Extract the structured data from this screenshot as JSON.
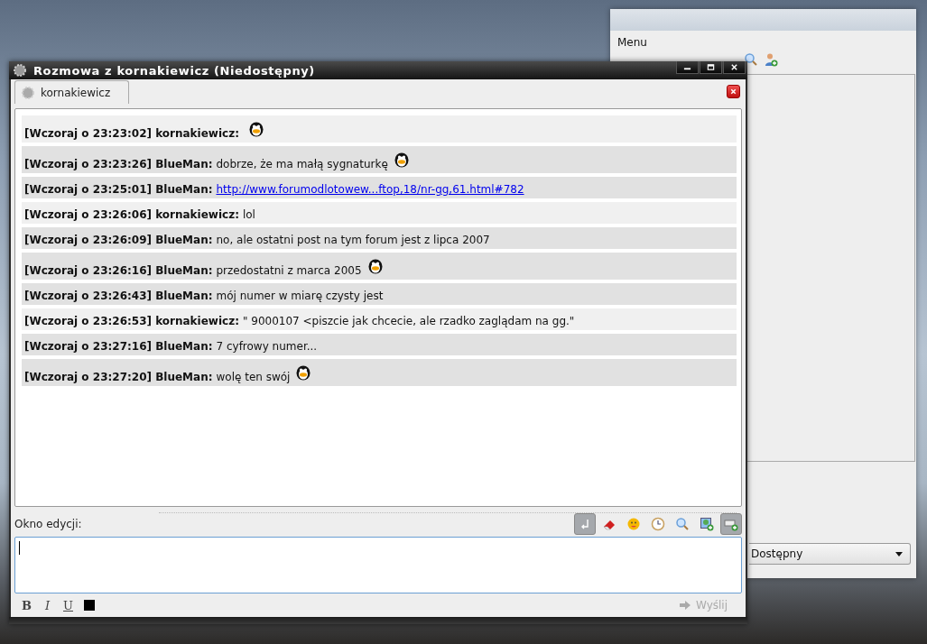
{
  "back_window": {
    "menu": "Menu",
    "status": "Dostępny"
  },
  "window": {
    "title": "Rozmowa z kornakiewicz (Niedostępny)"
  },
  "tabs": [
    {
      "label": "kornakiewicz",
      "selected": true
    }
  ],
  "messages": [
    {
      "kind": "incoming",
      "header": "[Wczoraj o 23:23:02] kornakiewicz:",
      "emoticon": true
    },
    {
      "kind": "outgoing",
      "header": "[Wczoraj o 23:23:26] BlueMan:",
      "text": "dobrze, że ma małą sygnaturkę",
      "emoticon": true
    },
    {
      "kind": "outgoing",
      "header": "[Wczoraj o 23:25:01] BlueMan:",
      "link": "http://www.forumodlotowew...ftop,18/nr-gg,61.html#782",
      "emoticon": false
    },
    {
      "kind": "incoming",
      "header": "[Wczoraj o 23:26:06] kornakiewicz:",
      "text": "lol",
      "emoticon": false
    },
    {
      "kind": "outgoing",
      "header": "[Wczoraj o 23:26:09] BlueMan:",
      "text": "no, ale ostatni post na tym forum jest z lipca 2007",
      "emoticon": false
    },
    {
      "kind": "outgoing",
      "header": "[Wczoraj o 23:26:16] BlueMan:",
      "text": "przedostatni z marca 2005",
      "emoticon": true
    },
    {
      "kind": "outgoing",
      "header": "[Wczoraj o 23:26:43] BlueMan:",
      "text": "mój numer w miarę czysty jest",
      "emoticon": false
    },
    {
      "kind": "incoming",
      "header": "[Wczoraj o 23:26:53] kornakiewicz:",
      "text": "\" 9000107 <piszcie jak chcecie, ale rzadko zaglądam na gg.\"",
      "emoticon": false
    },
    {
      "kind": "outgoing",
      "header": "[Wczoraj o 23:27:16] BlueMan:",
      "text": "7 cyfrowy numer...",
      "emoticon": false
    },
    {
      "kind": "outgoing",
      "header": "[Wczoraj o 23:27:20] BlueMan:",
      "text": "wolę ten swój",
      "emoticon": true
    }
  ],
  "editor": {
    "label": "Okno edycji:",
    "tools": [
      {
        "kind": "enter",
        "on": true
      },
      {
        "kind": "eraser",
        "on": false
      },
      {
        "kind": "emoticon",
        "on": false
      },
      {
        "kind": "clock",
        "on": false
      },
      {
        "kind": "search",
        "on": false
      },
      {
        "kind": "image",
        "on": false
      },
      {
        "kind": "add",
        "on": true
      }
    ],
    "format": [
      {
        "kind": "bold",
        "label": "B"
      },
      {
        "kind": "italic",
        "label": "I"
      },
      {
        "kind": "underline",
        "label": "U"
      },
      {
        "kind": "color",
        "color": "#000000"
      }
    ],
    "send": {
      "label": "Wyślij",
      "disabled": true
    }
  }
}
